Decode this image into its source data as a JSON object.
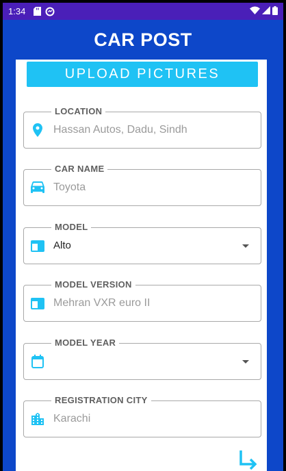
{
  "status_bar": {
    "time": "1:34"
  },
  "app_bar": {
    "title": "CAR POST"
  },
  "upload_button": {
    "label": "UPLOAD PICTURES"
  },
  "fields": {
    "location": {
      "label": "LOCATION",
      "value": "Hassan Autos, Dadu, Sindh",
      "icon": "location-pin-icon"
    },
    "car_name": {
      "label": "CAR NAME",
      "value": "Toyota",
      "icon": "car-icon"
    },
    "model": {
      "label": "MODEL",
      "value": "Alto",
      "icon": "card-icon"
    },
    "model_version": {
      "label": "MODEL VERSION",
      "value": "Mehran VXR euro II",
      "icon": "card-icon"
    },
    "model_year": {
      "label": "MODEL YEAR",
      "value": "",
      "icon": "calendar-icon"
    },
    "registration_city": {
      "label": "REGISTRATION CITY",
      "value": "Karachi",
      "icon": "city-icon"
    }
  },
  "colors": {
    "accent": "#1fc2f4",
    "primary": "#0d47c9",
    "status_bar": "#4a1fb8"
  }
}
